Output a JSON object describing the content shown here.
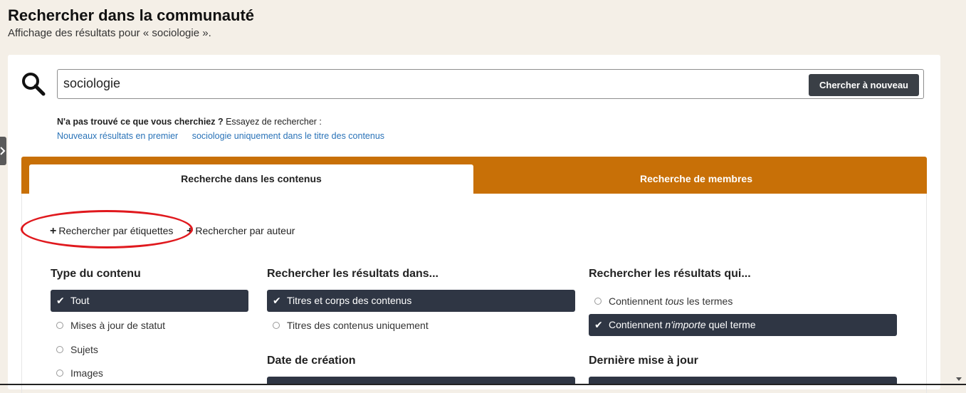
{
  "header": {
    "title": "Rechercher dans la communauté",
    "subtitle": "Affichage des résultats pour « sociologie »."
  },
  "search": {
    "value": "sociologie",
    "button_label": "Chercher à nouveau"
  },
  "suggestions": {
    "prompt_bold": "N'a pas trouvé ce que vous cherchiez ?",
    "prompt_rest": "Essayez de rechercher :",
    "links": [
      "Nouveaux résultats en premier",
      "sociologie uniquement dans le titre des contenus"
    ]
  },
  "tabs": [
    {
      "label": "Recherche dans les contenus",
      "active": true
    },
    {
      "label": "Recherche de membres",
      "active": false
    }
  ],
  "filters": {
    "by_tags": "Rechercher par étiquettes",
    "by_author": "Rechercher par auteur"
  },
  "content_type": {
    "heading": "Type du contenu",
    "options": [
      "Tout",
      "Mises à jour de statut",
      "Sujets",
      "Images"
    ],
    "selected": "Tout"
  },
  "search_in": {
    "heading": "Rechercher les résultats dans...",
    "options": [
      "Titres et corps des contenus",
      "Titres des contenus uniquement"
    ],
    "selected": "Titres et corps des contenus"
  },
  "match": {
    "heading": "Rechercher les résultats qui...",
    "option_all": {
      "pre": "Contiennent ",
      "em": "tous",
      "post": " les termes"
    },
    "option_any": {
      "pre": "Contiennent ",
      "em": "n'importe",
      "post": " quel terme"
    },
    "selected": "any"
  },
  "date_created": {
    "heading": "Date de création"
  },
  "last_updated": {
    "heading": "Dernière mise à jour"
  },
  "colors": {
    "accent_tab": "#c87007",
    "selected_option": "#2f3644",
    "link": "#2a73b8",
    "annotation": "#e0191e"
  }
}
